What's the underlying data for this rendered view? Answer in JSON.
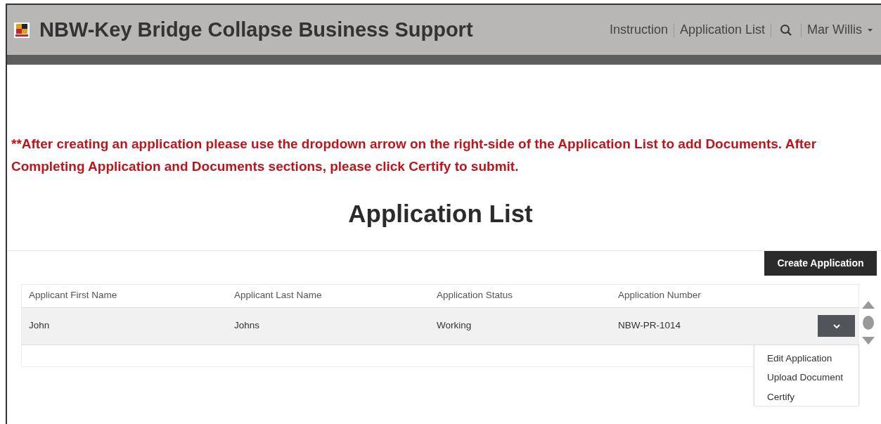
{
  "header": {
    "title": "NBW-Key Bridge Collapse Business Support",
    "nav": [
      {
        "kind": "link",
        "label": "Instruction"
      },
      {
        "kind": "link",
        "label": "Application List"
      },
      {
        "kind": "search"
      },
      {
        "kind": "user",
        "label": "Mar Willis"
      }
    ]
  },
  "notice": "**After creating an application please use the dropdown arrow on the right-side of the Application List to add Documents. After Completing Application and Documents sections, please click Certify to submit.",
  "heading": "Application List",
  "create_button": "Create Application",
  "table": {
    "columns": [
      "Applicant First Name",
      "Applicant Last Name",
      "Application Status",
      "Application Number"
    ],
    "rows": [
      {
        "cells": [
          "John",
          "Johns",
          "Working",
          "NBW-PR-1014"
        ],
        "expanded": true
      }
    ]
  },
  "row_menu": [
    "Edit Application",
    "Upload Document",
    "Certify"
  ]
}
